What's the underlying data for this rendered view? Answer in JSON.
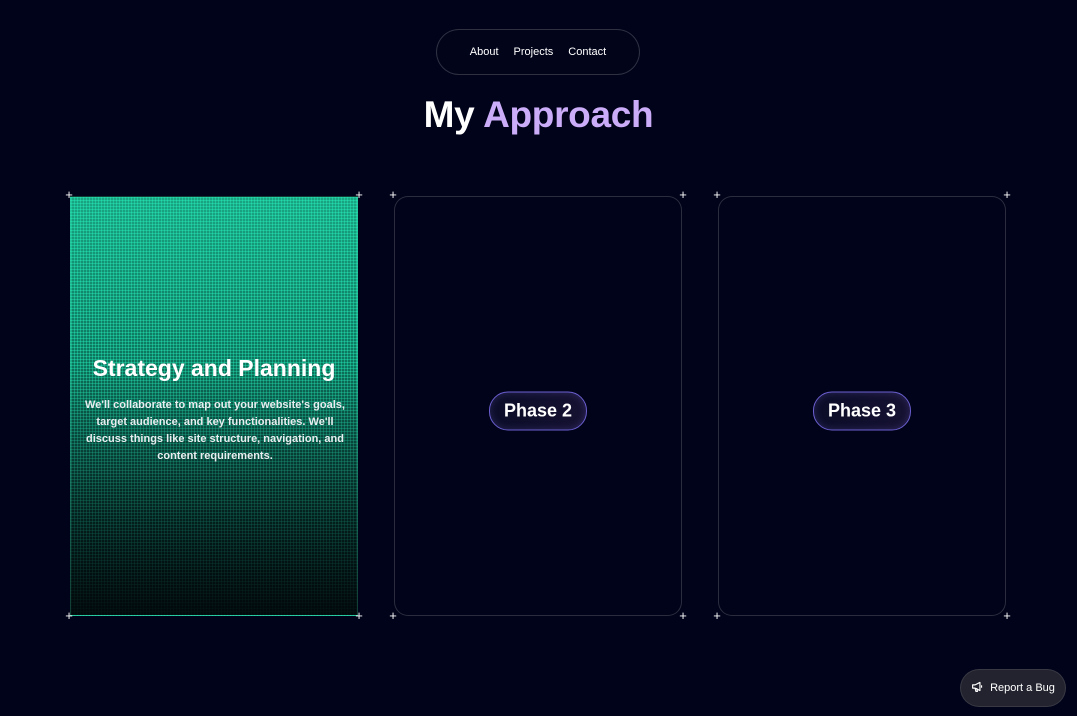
{
  "nav": {
    "items": [
      {
        "label": "About"
      },
      {
        "label": "Projects"
      },
      {
        "label": "Contact"
      }
    ]
  },
  "heading": {
    "prefix": "My",
    "accent": "Approach",
    "accent_color": "#cbacf9"
  },
  "cards": [
    {
      "title": "Strategy and Planning",
      "description": "We'll collaborate to map out your website's goals, target audience, and key functionalities. We'll discuss things like site structure, navigation, and content requirements."
    },
    {
      "phase_label": "Phase 2"
    },
    {
      "phase_label": "Phase 3"
    }
  ],
  "report_bug": {
    "label": "Report a Bug",
    "icon": "megaphone-icon"
  },
  "colors": {
    "background": "#000319",
    "card_active_accent": "#1aa583",
    "pill_border": "#6a5fd0"
  }
}
